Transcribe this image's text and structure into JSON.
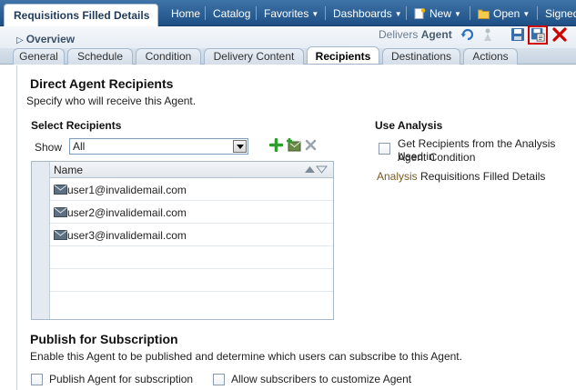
{
  "header": {
    "title": "Requisitions Filled Details",
    "nav": [
      {
        "label": "Home"
      },
      {
        "label": "Catalog"
      },
      {
        "label": "Favorites"
      },
      {
        "label": "Dashboards"
      },
      {
        "label": "New"
      },
      {
        "label": "Open"
      },
      {
        "label": "Signed"
      }
    ]
  },
  "overview": {
    "title": "Overview",
    "delivers_prefix": "Delivers",
    "delivers_target": "Agent"
  },
  "tabs": [
    {
      "label": "General"
    },
    {
      "label": "Schedule"
    },
    {
      "label": "Condition"
    },
    {
      "label": "Delivery Content"
    },
    {
      "label": "Recipients"
    },
    {
      "label": "Destinations"
    },
    {
      "label": "Actions"
    }
  ],
  "active_tab": "Recipients",
  "direct": {
    "heading": "Direct Agent Recipients",
    "description": "Specify who will receive this Agent.",
    "select_heading": "Select Recipients",
    "show_label": "Show",
    "show_value": "All",
    "column_name": "Name",
    "recipients": [
      "user1@invalidemail.com",
      "user2@invalidemail.com",
      "user3@invalidemail.com"
    ]
  },
  "analysis": {
    "heading": "Use Analysis",
    "checkbox_label_1": "Get Recipients from the Analysis Used in",
    "checkbox_label_2": "Agent Condition",
    "analysis_label": "Analysis",
    "analysis_value": "Requisitions Filled Details"
  },
  "publish": {
    "heading": "Publish for Subscription",
    "description": "Enable this Agent to be published and determine which users can subscribe to this Agent.",
    "publish_label": "Publish Agent for subscription",
    "customize_label": "Allow subscribers to customize Agent"
  },
  "colors": {
    "nav_bg": "#2a5e94",
    "accent_green": "#2e9e2e",
    "highlight_red": "#d00000"
  }
}
